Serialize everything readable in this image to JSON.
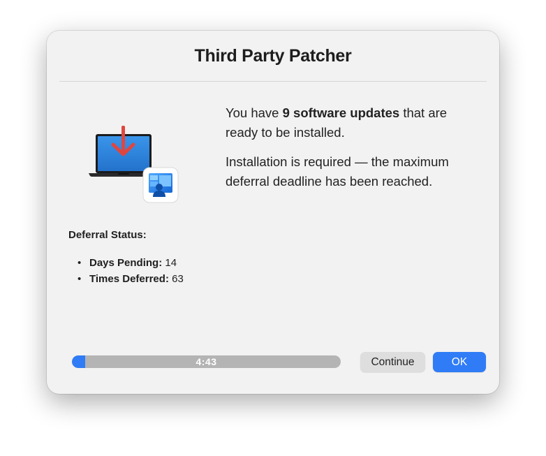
{
  "dialog": {
    "title": "Third Party Patcher"
  },
  "message": {
    "line1_pre": "You have ",
    "line1_bold": "9 software updates",
    "line1_post": " that are ready to be installed.",
    "line2": "Installation is required — the maximum deferral deadline has been reached."
  },
  "icons": {
    "hero": "laptop-download-icon",
    "badge": "company-portal-icon"
  },
  "deferral": {
    "heading": "Deferral Status:",
    "items": [
      {
        "bullet": "•",
        "label": "Days Pending:",
        "value": " 14"
      },
      {
        "bullet": "•",
        "label": "Times Deferred:",
        "value": " 63"
      }
    ]
  },
  "countdown": {
    "time": "4:43",
    "progress_fraction": 0.05
  },
  "buttons": {
    "continue_label": "Continue",
    "ok_label": "OK"
  },
  "colors": {
    "accent": "#2f7cf6",
    "arrow": "#e0463f",
    "screen": "#2f86e0"
  }
}
